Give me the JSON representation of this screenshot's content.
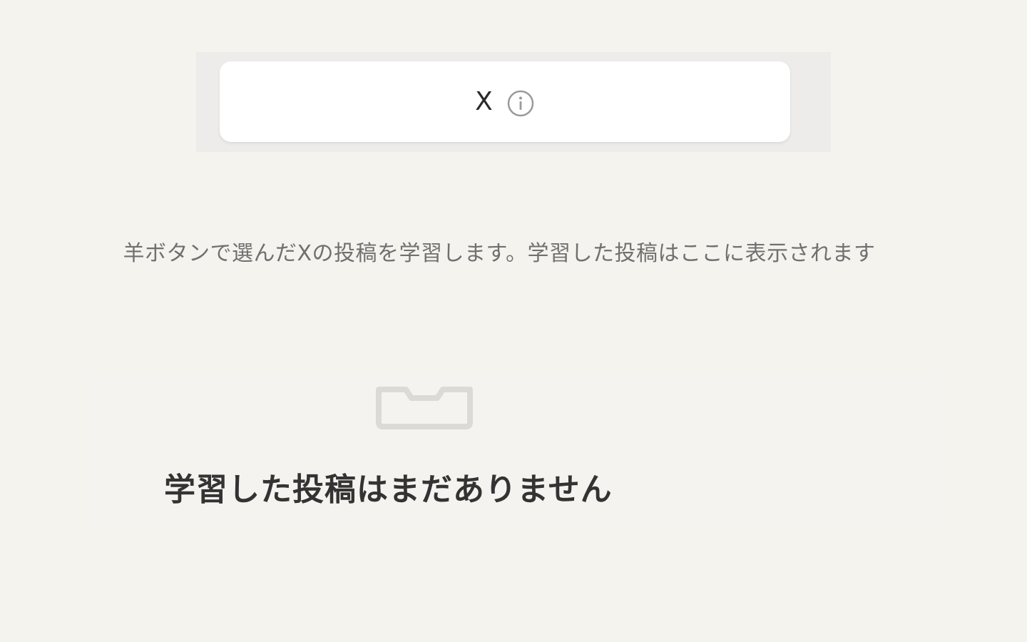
{
  "tabs": {
    "active_label": "X"
  },
  "description": "羊ボタンで選んだXの投稿を学習します。学習した投稿はここに表示されます",
  "empty_state": {
    "title": "学習した投稿はまだありません",
    "icon": "inbox-icon"
  },
  "colors": {
    "background": "#f5f3ee",
    "tab_bar": "#edecea",
    "tab_active": "#ffffff",
    "text_primary": "#2b2b2b",
    "text_secondary": "#707070",
    "icon": "#dcdad6"
  }
}
